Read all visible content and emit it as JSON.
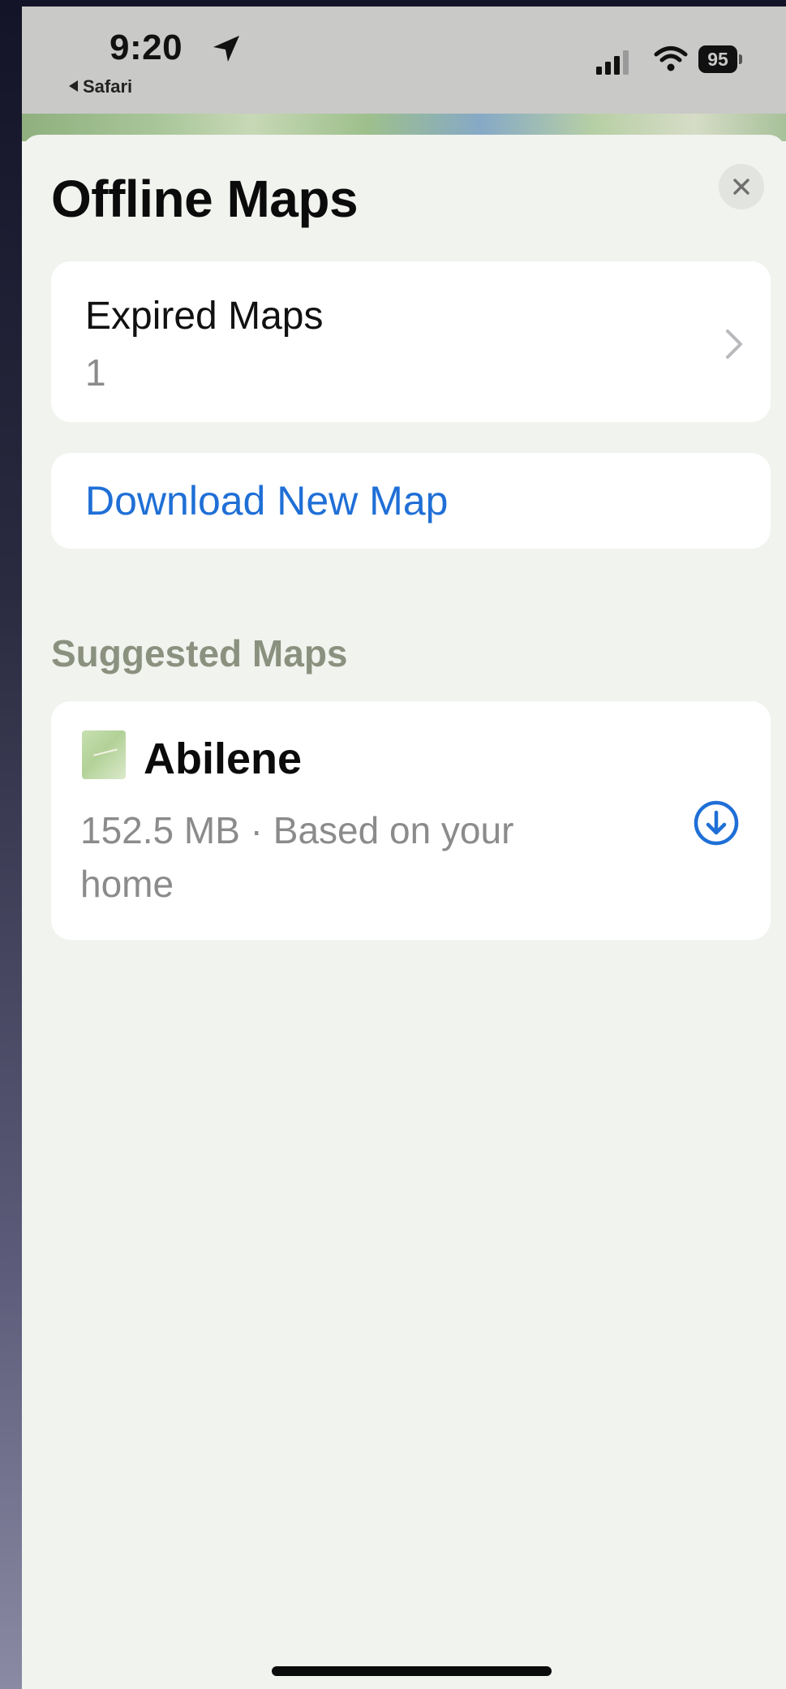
{
  "status_bar": {
    "time": "9:20",
    "back_app": "Safari",
    "battery": "95"
  },
  "header": {
    "title": "Offline Maps"
  },
  "expired_maps": {
    "label": "Expired Maps",
    "count": "1"
  },
  "download_new": {
    "label": "Download New Map"
  },
  "suggested": {
    "header": "Suggested Maps",
    "items": [
      {
        "name": "Abilene",
        "detail": "152.5 MB · Based on your home"
      }
    ]
  },
  "colors": {
    "accent": "#1f6fd6",
    "sheet_bg": "#f1f3ee",
    "card_bg": "#ffffff",
    "secondary_text": "#8b8b8b",
    "section_header": "#8b917f"
  },
  "icons": {
    "location": "location-arrow-icon",
    "signal": "cellular-signal-icon",
    "wifi": "wifi-icon",
    "battery": "battery-icon",
    "close": "close-icon",
    "chevron": "chevron-right-icon",
    "download": "download-circle-icon",
    "map_thumbnail": "map-thumbnail-icon"
  }
}
